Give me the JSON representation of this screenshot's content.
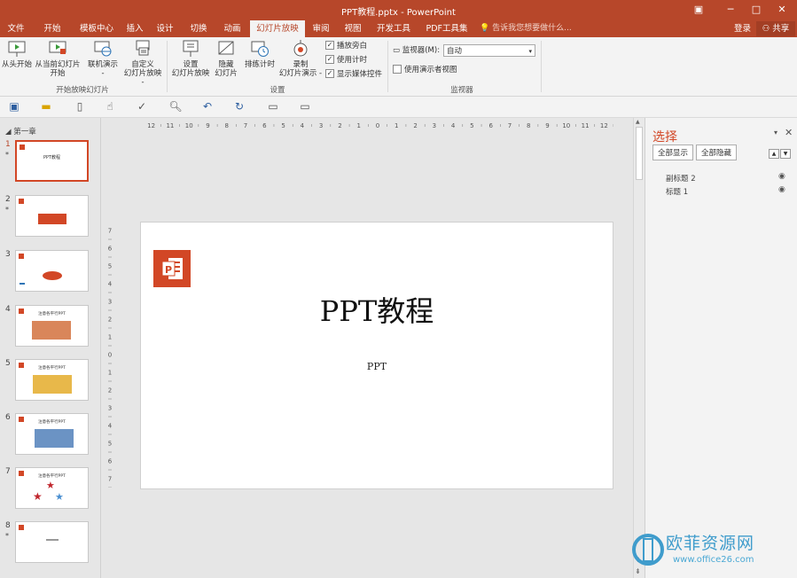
{
  "window": {
    "title": "PPT教程.pptx - PowerPoint",
    "restore_icon": "ribbon-display-icon",
    "min": "─",
    "max": "□",
    "close": "✕"
  },
  "tabs": [
    "文件",
    "开始",
    "模板中心",
    "插入",
    "设计",
    "切换",
    "动画",
    "幻灯片放映",
    "审阅",
    "视图",
    "开发工具",
    "PDF工具集"
  ],
  "active_tab": "幻灯片放映",
  "tellme": "告诉我您想要做什么...",
  "signin": "登录",
  "share": "共享",
  "ribbon": {
    "from_start": "从头开始",
    "from_current_1": "从当前幻灯片",
    "from_current_2": "开始",
    "online_1": "联机演示",
    "online_2": "-",
    "custom_1": "自定义",
    "custom_2": "幻灯片放映 -",
    "group_start": "开始放映幻灯片",
    "setup_1": "设置",
    "setup_2": "幻灯片放映",
    "hide_1": "隐藏",
    "hide_2": "幻灯片",
    "rehearse": "排练计时",
    "record_1": "录制",
    "record_2": "幻灯片演示 -",
    "cb_narration": "播放旁白",
    "cb_timings": "使用计时",
    "cb_media": "显示媒体控件",
    "group_setup": "设置",
    "monitor_label": "监视器(M):",
    "monitor_value": "自动",
    "presenter_view": "使用演示者视图",
    "group_monitor": "监视器"
  },
  "thumbs": {
    "section": "第一章",
    "slides": [
      {
        "num": "1",
        "star": "*",
        "text": "PPT教程"
      },
      {
        "num": "2",
        "star": "*",
        "text": ""
      },
      {
        "num": "3",
        "star": "",
        "text": ""
      },
      {
        "num": "4",
        "star": "",
        "text": "注意各平行PPT"
      },
      {
        "num": "5",
        "star": "",
        "text": "注意各平行PPT"
      },
      {
        "num": "6",
        "star": "",
        "text": "注意各平行PPT"
      },
      {
        "num": "7",
        "star": "",
        "text": "注意各平行PPT"
      },
      {
        "num": "8",
        "star": "*",
        "text": ""
      }
    ]
  },
  "slide": {
    "title": "PPT教程",
    "subtitle": "PPT"
  },
  "selection_pane": {
    "title": "选择",
    "show_all": "全部显示",
    "hide_all": "全部隐藏",
    "items": [
      "副标题 2",
      "标题 1"
    ]
  },
  "watermark": {
    "text": "欧菲资源网",
    "url": "www.office26.com"
  },
  "colors": {
    "accent": "#b7472a",
    "ppt_logo": "#d24726"
  }
}
